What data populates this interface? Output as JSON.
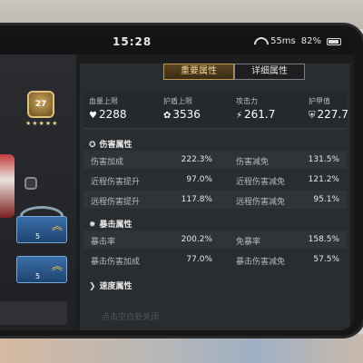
{
  "status_bar": {
    "time": "15:28",
    "network": "55ms",
    "battery": "82%"
  },
  "left_panel": {
    "rank": "27",
    "rank_stars": "★★★★★",
    "card1_level": "5",
    "card2_level": "5"
  },
  "tabs": [
    {
      "label": "重要属性",
      "active": true
    },
    {
      "label": "详细属性",
      "active": false
    }
  ],
  "summary": [
    {
      "label": "血量上限",
      "icon": "♥",
      "value": "2288"
    },
    {
      "label": "护盾上限",
      "icon": "✿",
      "value": "3536"
    },
    {
      "label": "攻击力",
      "icon": "⚡",
      "value": "261.7"
    },
    {
      "label": "护甲值",
      "icon": "⛨",
      "value": "227.7"
    }
  ],
  "sections": {
    "damage": {
      "title": "伤害属性",
      "rows": [
        {
          "l1": "伤害加成",
          "v1": "222.3%",
          "l2": "伤害减免",
          "v2": "131.5%"
        },
        {
          "l1": "近程伤害提升",
          "v1": "97.0%",
          "l2": "近程伤害减免",
          "v2": "121.2%"
        },
        {
          "l1": "远程伤害提升",
          "v1": "117.8%",
          "l2": "远程伤害减免",
          "v2": "95.1%"
        }
      ]
    },
    "crit": {
      "title": "暴击属性",
      "rows": [
        {
          "l1": "暴击率",
          "v1": "200.2%",
          "l2": "免暴率",
          "v2": "158.5%"
        },
        {
          "l1": "暴击伤害加成",
          "v1": "77.0%",
          "l2": "暴击伤害减免",
          "v2": "57.5%"
        }
      ]
    },
    "speed": {
      "title": "速度属性"
    }
  },
  "bottom_hint": "点击空白处关闭"
}
